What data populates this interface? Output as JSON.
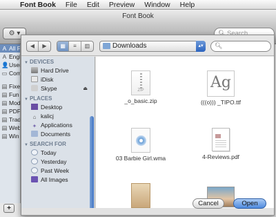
{
  "menubar": {
    "apple_glyph": "",
    "items": [
      {
        "label": "Font Book"
      },
      {
        "label": "File"
      },
      {
        "label": "Edit"
      },
      {
        "label": "Preview"
      },
      {
        "label": "Window"
      },
      {
        "label": "Help"
      }
    ]
  },
  "window": {
    "title": "Font Book",
    "search_placeholder": "Search",
    "gear_label": "⚙︎ ▾"
  },
  "font_collections": [
    {
      "glyph": "A",
      "label": "All F",
      "selected": true
    },
    {
      "glyph": "A",
      "label": "Engl"
    },
    {
      "glyph": "👤",
      "label": "User"
    },
    {
      "glyph": "▭",
      "label": "Com"
    },
    {
      "glyph": "",
      "label": ""
    },
    {
      "glyph": "▤",
      "label": "Fixe"
    },
    {
      "glyph": "▤",
      "label": "Fun"
    },
    {
      "glyph": "▤",
      "label": "Mod"
    },
    {
      "glyph": "▤",
      "label": "PDF"
    },
    {
      "glyph": "▤",
      "label": "Trad"
    },
    {
      "glyph": "▤",
      "label": "Web"
    },
    {
      "glyph": "▤",
      "label": "Win"
    }
  ],
  "add_button": "+",
  "dialog": {
    "nav": {
      "back": "◀",
      "forward": "▶"
    },
    "view": {
      "icons": "▦",
      "list": "≡",
      "columns": "▥"
    },
    "location": "Downloads",
    "sidebar": {
      "devices_header": "DEVICES",
      "devices": [
        {
          "label": "Hard Drive",
          "icon": "hard-drive-icon"
        },
        {
          "label": "iDisk",
          "icon": "idisk-icon"
        },
        {
          "label": "Skype",
          "icon": "skype-volume-icon",
          "eject": "⏏"
        }
      ],
      "places_header": "PLACES",
      "places": [
        {
          "label": "Desktop",
          "icon": "desktop-icon"
        },
        {
          "label": "kalicj",
          "icon": "home-icon"
        },
        {
          "label": "Applications",
          "icon": "applications-icon"
        },
        {
          "label": "Documents",
          "icon": "documents-icon"
        }
      ],
      "search_header": "SEARCH FOR",
      "searches": [
        {
          "label": "Today",
          "icon": "clock-icon"
        },
        {
          "label": "Yesterday",
          "icon": "clock-icon"
        },
        {
          "label": "Past Week",
          "icon": "clock-icon"
        },
        {
          "label": "All Images",
          "icon": "smart-folder-icon"
        }
      ]
    },
    "files": [
      {
        "label": "_o_basic.zip",
        "icon": "zip-file-icon",
        "tag": "ZIP"
      },
      {
        "label": "(((o))) _TIPO.ttf",
        "icon": "font-file-icon",
        "preview": "Ag"
      },
      {
        "label": "03 Barbie Girl.wma",
        "icon": "audio-file-icon"
      },
      {
        "label": "4-Reviews.pdf",
        "icon": "pdf-file-icon",
        "tag": "PDF"
      },
      {
        "label": "",
        "icon": "pdf-file-icon",
        "tag": "PDF"
      },
      {
        "label": "",
        "icon": "image-file-icon"
      }
    ],
    "cancel_label": "Cancel",
    "open_label": "Open"
  }
}
